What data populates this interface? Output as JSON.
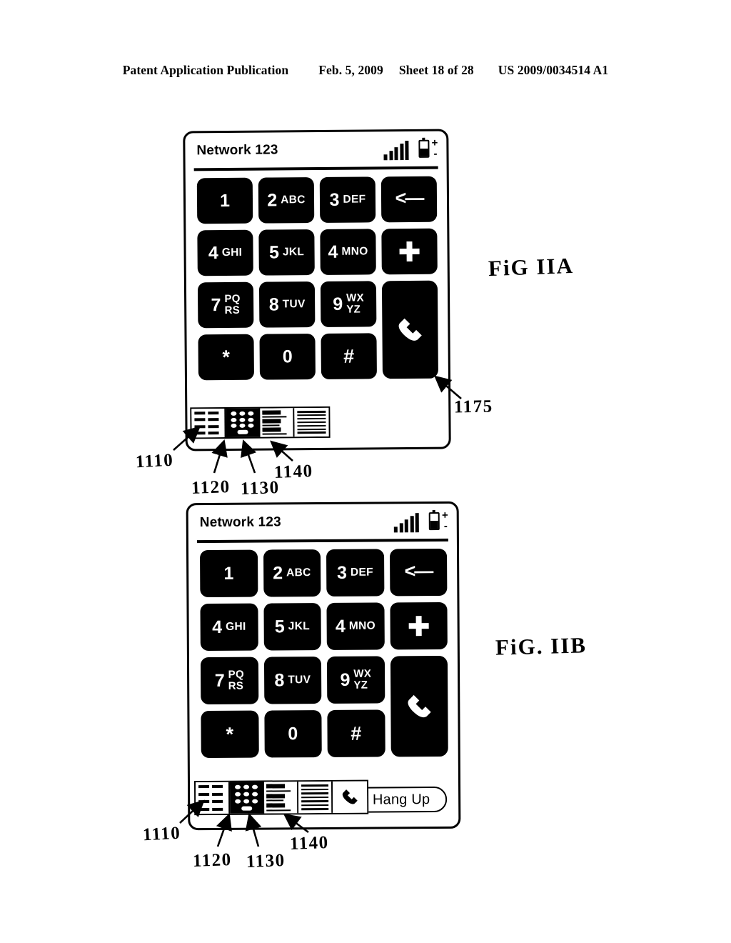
{
  "header": {
    "publication": "Patent Application Publication",
    "date": "Feb. 5, 2009",
    "sheet": "Sheet 18 of 28",
    "patent_number": "US 2009/0034514 A1"
  },
  "figures": [
    {
      "id": "fig-11a",
      "label": "FiG  IIA",
      "status_bar": {
        "network": "Network 123",
        "signal_icon": "signal-bars-icon",
        "signal_bars": 5,
        "battery_icon": "battery-icon",
        "battery_plus": "+",
        "battery_minus": "-"
      },
      "keys": [
        {
          "name": "key-1",
          "digit": "1",
          "letters": "",
          "type": "digit"
        },
        {
          "name": "key-2",
          "digit": "2",
          "letters": "ABC",
          "type": "digit"
        },
        {
          "name": "key-3",
          "digit": "3",
          "letters": "DEF",
          "type": "digit"
        },
        {
          "name": "key-backspace",
          "digit": "",
          "letters": "",
          "glyph": "<—",
          "type": "back"
        },
        {
          "name": "key-4",
          "digit": "4",
          "letters": "GHI",
          "type": "digit"
        },
        {
          "name": "key-5",
          "digit": "5",
          "letters": "JKL",
          "type": "digit"
        },
        {
          "name": "key-6",
          "digit": "4",
          "letters": "MNO",
          "type": "digit"
        },
        {
          "name": "key-plus",
          "digit": "",
          "letters": "",
          "type": "plus"
        },
        {
          "name": "key-7",
          "digit": "7",
          "letters": "PQ\nRS",
          "type": "digit-stack"
        },
        {
          "name": "key-8",
          "digit": "8",
          "letters": "TUV",
          "type": "digit"
        },
        {
          "name": "key-9",
          "digit": "9",
          "letters": "WX\nYZ",
          "type": "digit-stack"
        },
        {
          "name": "key-call",
          "digit": "",
          "letters": "",
          "type": "call"
        },
        {
          "name": "key-star",
          "digit": "*",
          "letters": "",
          "type": "sym"
        },
        {
          "name": "key-0",
          "digit": "0",
          "letters": "",
          "type": "digit"
        },
        {
          "name": "key-hash",
          "digit": "#",
          "letters": "",
          "type": "sym"
        }
      ],
      "taskbar": [
        {
          "name": "taskbar-cell-dashes",
          "icon": "grid-dashes-icon",
          "selected": false
        },
        {
          "name": "taskbar-cell-keypad",
          "icon": "keypad-dots-icon",
          "selected": true
        },
        {
          "name": "taskbar-cell-list",
          "icon": "list-bars-icon",
          "selected": false
        },
        {
          "name": "taskbar-cell-lines",
          "icon": "text-lines-icon",
          "selected": false
        }
      ],
      "callouts": [
        {
          "name": "callout-1110",
          "text": "1110"
        },
        {
          "name": "callout-1120",
          "text": "1120"
        },
        {
          "name": "callout-1130",
          "text": "1130"
        },
        {
          "name": "callout-1140",
          "text": "1140"
        },
        {
          "name": "callout-1175",
          "text": "1175"
        }
      ]
    },
    {
      "id": "fig-11b",
      "label": "FiG. IIB",
      "status_bar": {
        "network": "Network 123",
        "signal_icon": "signal-bars-icon",
        "signal_bars": 5,
        "battery_icon": "battery-icon",
        "battery_plus": "+",
        "battery_minus": "-"
      },
      "keys": [
        {
          "name": "key-1",
          "digit": "1",
          "letters": "",
          "type": "digit"
        },
        {
          "name": "key-2",
          "digit": "2",
          "letters": "ABC",
          "type": "digit"
        },
        {
          "name": "key-3",
          "digit": "3",
          "letters": "DEF",
          "type": "digit"
        },
        {
          "name": "key-backspace",
          "digit": "",
          "letters": "",
          "glyph": "<—",
          "type": "back"
        },
        {
          "name": "key-4",
          "digit": "4",
          "letters": "GHI",
          "type": "digit"
        },
        {
          "name": "key-5",
          "digit": "5",
          "letters": "JKL",
          "type": "digit"
        },
        {
          "name": "key-6",
          "digit": "4",
          "letters": "MNO",
          "type": "digit"
        },
        {
          "name": "key-plus",
          "digit": "",
          "letters": "",
          "type": "plus"
        },
        {
          "name": "key-7",
          "digit": "7",
          "letters": "PQ\nRS",
          "type": "digit-stack"
        },
        {
          "name": "key-8",
          "digit": "8",
          "letters": "TUV",
          "type": "digit"
        },
        {
          "name": "key-9",
          "digit": "9",
          "letters": "WX\nYZ",
          "type": "digit-stack"
        },
        {
          "name": "key-call",
          "digit": "",
          "letters": "",
          "type": "call"
        },
        {
          "name": "key-star",
          "digit": "*",
          "letters": "",
          "type": "sym"
        },
        {
          "name": "key-0",
          "digit": "0",
          "letters": "",
          "type": "digit"
        },
        {
          "name": "key-hash",
          "digit": "#",
          "letters": "",
          "type": "sym"
        }
      ],
      "taskbar": [
        {
          "name": "taskbar-cell-dashes",
          "icon": "grid-dashes-icon",
          "selected": false
        },
        {
          "name": "taskbar-cell-keypad",
          "icon": "keypad-dots-icon",
          "selected": true
        },
        {
          "name": "taskbar-cell-list",
          "icon": "list-bars-icon",
          "selected": false
        },
        {
          "name": "taskbar-cell-lines",
          "icon": "text-lines-icon",
          "selected": false
        },
        {
          "name": "taskbar-cell-handset",
          "icon": "handset-icon",
          "selected": false
        }
      ],
      "hang_up_label": "Hang Up",
      "callouts": [
        {
          "name": "callout-1110",
          "text": "1110"
        },
        {
          "name": "callout-1120",
          "text": "1120"
        },
        {
          "name": "callout-1130",
          "text": "1130"
        },
        {
          "name": "callout-1140",
          "text": "1140"
        }
      ]
    }
  ]
}
